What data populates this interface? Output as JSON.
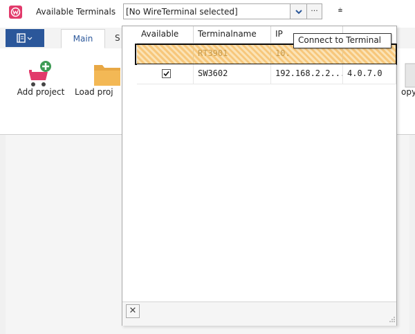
{
  "titlebar": {
    "available_terminals_label": "Available Terminals",
    "terminal_combo_value": "[No WireTerminal selected]",
    "ellipsis_label": "···",
    "qat_glyph": "⩧",
    "accent_color": "#e23a6b"
  },
  "ribbon": {
    "tabs": [
      {
        "label": "Main"
      },
      {
        "label": "S"
      }
    ],
    "buttons": {
      "add_project": "Add project",
      "load_project": "Load proj",
      "copy_partial": "opy c"
    },
    "file_tab_color": "#2b579a"
  },
  "terminal_grid": {
    "columns": [
      "Available",
      "Terminalname",
      "IP",
      ""
    ],
    "rows": [
      {
        "available": "",
        "terminalname": "RT3901",
        "ip": "10.",
        "version": "",
        "state": "highlighted-disabled"
      },
      {
        "available": "checked",
        "terminalname": "SW3602",
        "ip": "192.168.2.2...",
        "version": "4.0.7.0",
        "state": "normal"
      }
    ],
    "tooltip": "Connect to Terminal",
    "close_glyph": "✕"
  }
}
